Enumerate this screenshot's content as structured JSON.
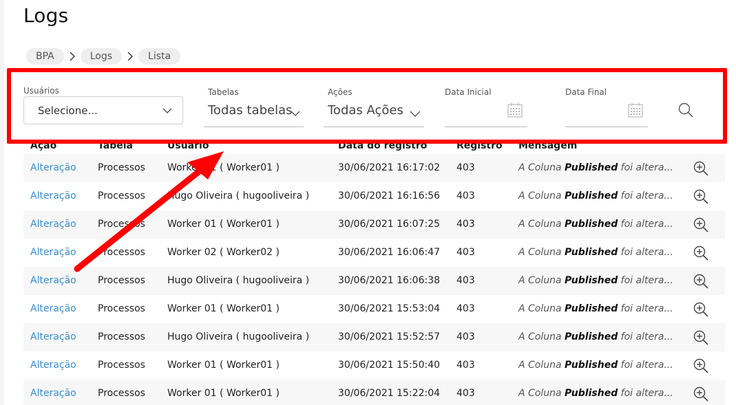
{
  "page": {
    "title": "Logs"
  },
  "breadcrumb": [
    "BPA",
    "Logs",
    "Lista"
  ],
  "filters": {
    "usuarios": {
      "label": "Usuários",
      "value": "Selecione..."
    },
    "tabelas": {
      "label": "Tabelas",
      "value": "Todas tabelas"
    },
    "acoes": {
      "label": "Ações",
      "value": "Todas Ações"
    },
    "data_inicial": {
      "label": "Data Inicial"
    },
    "data_final": {
      "label": "Data Final"
    }
  },
  "table": {
    "headers": [
      "Ação",
      "Tabela",
      "Usuário",
      "Data do registro",
      "Registro",
      "Mensagem"
    ],
    "rows": [
      {
        "acao": "Alteração",
        "tabela": "Processos",
        "usuario": "Worker 01 ( Worker01 )",
        "data": "30/06/2021 16:17:02",
        "registro": "403",
        "msg_pre": "A Coluna",
        "msg_bold": "Published",
        "msg_post": "foi altera..."
      },
      {
        "acao": "Alteração",
        "tabela": "Processos",
        "usuario": "Hugo Oliveira ( hugooliveira )",
        "data": "30/06/2021 16:16:56",
        "registro": "403",
        "msg_pre": "A Coluna",
        "msg_bold": "Published",
        "msg_post": "foi altera..."
      },
      {
        "acao": "Alteração",
        "tabela": "Processos",
        "usuario": "Worker 01 ( Worker01 )",
        "data": "30/06/2021 16:07:25",
        "registro": "403",
        "msg_pre": "A Coluna",
        "msg_bold": "Published",
        "msg_post": "foi altera..."
      },
      {
        "acao": "Alteração",
        "tabela": "Processos",
        "usuario": "Worker 02 ( Worker02 )",
        "data": "30/06/2021 16:06:47",
        "registro": "403",
        "msg_pre": "A Coluna",
        "msg_bold": "Published",
        "msg_post": "foi altera..."
      },
      {
        "acao": "Alteração",
        "tabela": "Processos",
        "usuario": "Hugo Oliveira ( hugooliveira )",
        "data": "30/06/2021 16:06:38",
        "registro": "403",
        "msg_pre": "A Coluna",
        "msg_bold": "Published",
        "msg_post": "foi altera..."
      },
      {
        "acao": "Alteração",
        "tabela": "Processos",
        "usuario": "Worker 01 ( Worker01 )",
        "data": "30/06/2021 15:53:04",
        "registro": "403",
        "msg_pre": "A Coluna",
        "msg_bold": "Published",
        "msg_post": "foi altera..."
      },
      {
        "acao": "Alteração",
        "tabela": "Processos",
        "usuario": "Hugo Oliveira ( hugooliveira )",
        "data": "30/06/2021 15:52:57",
        "registro": "403",
        "msg_pre": "A Coluna",
        "msg_bold": "Published",
        "msg_post": "foi altera..."
      },
      {
        "acao": "Alteração",
        "tabela": "Processos",
        "usuario": "Worker 01 ( Worker01 )",
        "data": "30/06/2021 15:50:40",
        "registro": "403",
        "msg_pre": "A Coluna",
        "msg_bold": "Published",
        "msg_post": "foi altera..."
      },
      {
        "acao": "Alteração",
        "tabela": "Processos",
        "usuario": "Worker 01 ( Worker01 )",
        "data": "30/06/2021 15:22:04",
        "registro": "403",
        "msg_pre": "A Coluna",
        "msg_bold": "Published",
        "msg_post": "foi altera..."
      }
    ]
  },
  "colors": {
    "link": "#3a8fd0",
    "highlight": "#ff0000",
    "row_alt": "#f7f7f7"
  },
  "icons": {
    "search": "search-icon",
    "zoom": "zoom-in-icon",
    "calendar": "calendar-icon",
    "chevron": "chevron-down-icon"
  }
}
